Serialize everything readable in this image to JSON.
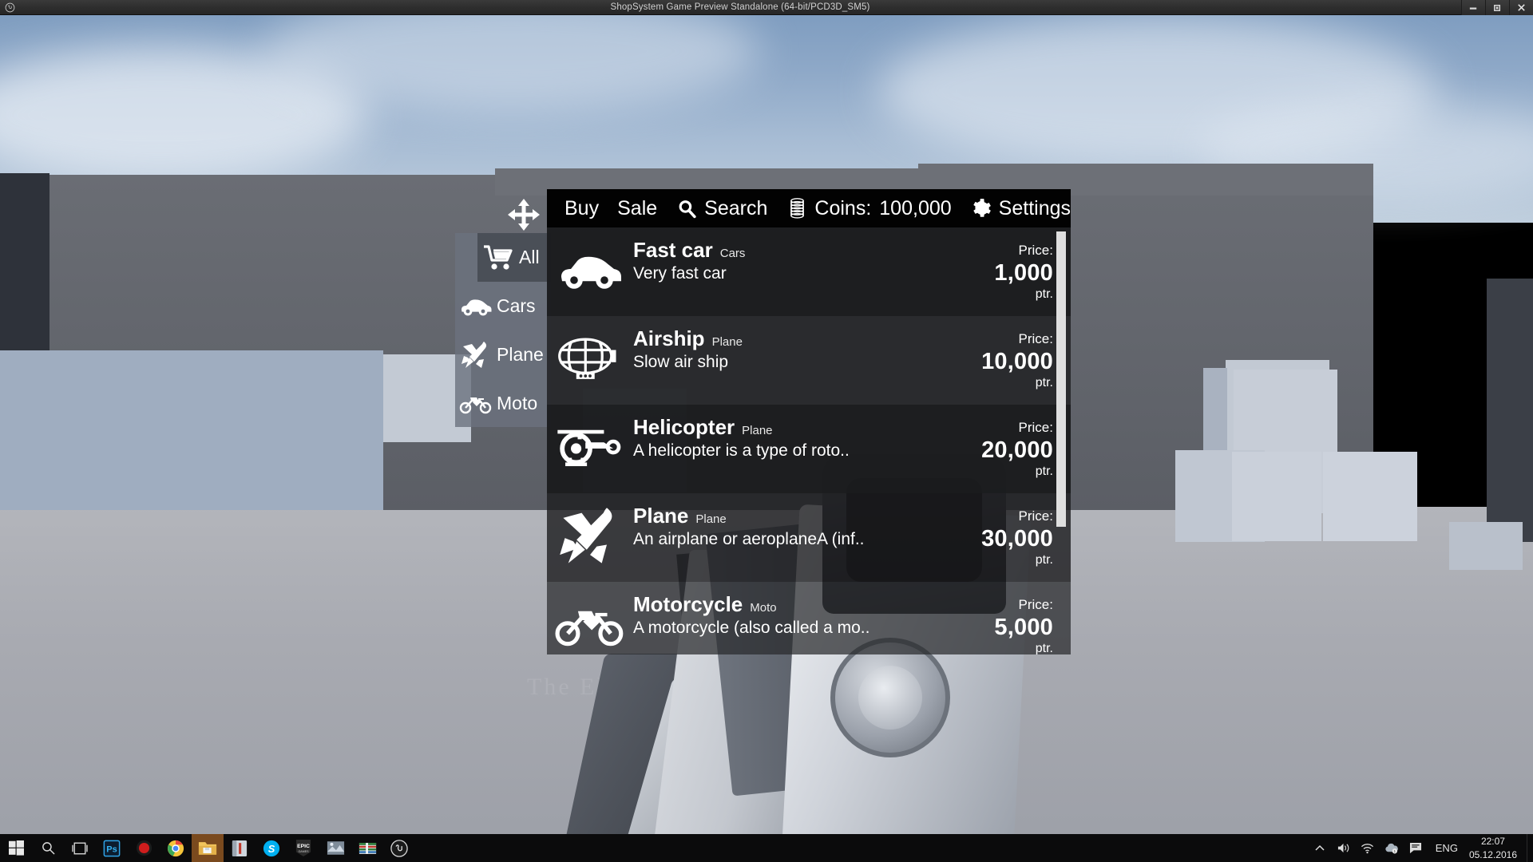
{
  "window": {
    "title": "ShopSystem Game Preview Standalone (64-bit/PCD3D_SM5)",
    "app_icon": "unreal-logo-icon",
    "controls": {
      "minimize": "–",
      "restore": "❐",
      "close": "✕"
    }
  },
  "scene": {
    "watermark": "The Elder Scrolls  V"
  },
  "shop": {
    "move_handle_icon": "move-cross-icon",
    "toolbar": {
      "buy_label": "Buy",
      "sale_label": "Sale",
      "search_icon": "search-icon",
      "search_label": "Search",
      "coins_icon": "coins-stack-icon",
      "coins_label": "Coins:",
      "coins_value": "100,000",
      "settings_icon": "gear-icon",
      "settings_label": "Settings"
    },
    "categories": [
      {
        "id": "all",
        "label": "All",
        "icon": "shopping-cart-icon",
        "active": true
      },
      {
        "id": "cars",
        "label": "Cars",
        "icon": "car-icon",
        "active": false
      },
      {
        "id": "plane",
        "label": "Plane",
        "icon": "jet-plane-icon",
        "active": false
      },
      {
        "id": "moto",
        "label": "Moto",
        "icon": "motorcycle-icon",
        "active": false
      }
    ],
    "price_label": "Price:",
    "price_unit": "ptr.",
    "items": [
      {
        "name": "Fast car",
        "category": "Cars",
        "desc": "Very fast car",
        "price": "1,000",
        "icon": "car-icon"
      },
      {
        "name": "Airship",
        "category": "Plane",
        "desc": "Slow air ship",
        "price": "10,000",
        "icon": "airship-icon"
      },
      {
        "name": "Helicopter",
        "category": "Plane",
        "desc": "A helicopter is a type of roto..",
        "price": "20,000",
        "icon": "helicopter-icon"
      },
      {
        "name": "Plane",
        "category": "Plane",
        "desc": "An airplane or aeroplaneA (inf..",
        "price": "30,000",
        "icon": "jet-plane-icon"
      },
      {
        "name": "Motorcycle",
        "category": "Moto",
        "desc": "A motorcycle (also called a mo..",
        "price": "5,000",
        "icon": "motorcycle-icon"
      }
    ],
    "scrollbar": {
      "thumb_color": "#dfdfdf"
    }
  },
  "taskbar": {
    "items": [
      {
        "name": "start-button",
        "icon": "windows-logo-icon",
        "active": false
      },
      {
        "name": "search-button",
        "icon": "search-icon",
        "active": false
      },
      {
        "name": "task-view-button",
        "icon": "task-view-icon",
        "active": false
      },
      {
        "name": "photoshop-button",
        "icon": "photoshop-icon",
        "active": false
      },
      {
        "name": "recorder-button",
        "icon": "record-icon",
        "active": false
      },
      {
        "name": "chrome-button",
        "icon": "chrome-icon",
        "active": false
      },
      {
        "name": "explorer-button",
        "icon": "folder-icon",
        "active": true
      },
      {
        "name": "app-button",
        "icon": "book-icon",
        "active": false
      },
      {
        "name": "skype-button",
        "icon": "skype-icon",
        "active": false
      },
      {
        "name": "epic-games-button",
        "icon": "epic-games-icon",
        "active": false
      },
      {
        "name": "paint-button",
        "icon": "paint-icon",
        "active": false
      },
      {
        "name": "winrar-button",
        "icon": "winrar-icon",
        "active": false
      },
      {
        "name": "unreal-button",
        "icon": "unreal-logo-icon",
        "active": false
      }
    ],
    "tray": {
      "chevron_icon": "chevron-up-icon",
      "volume_icon": "speaker-icon",
      "wifi_icon": "wifi-icon",
      "onedrive_icon": "cloud-icon",
      "action_center_icon": "notification-icon",
      "language": "ENG",
      "time": "22:07",
      "date": "05.12.2016"
    }
  },
  "colors": {
    "panel_bg": "#1b1c1e",
    "toolbar_bg": "#020202",
    "sidebar_bg": "#6c727e",
    "crosshair": "#8c2f22",
    "taskbar_active": "#7a4a1e"
  }
}
